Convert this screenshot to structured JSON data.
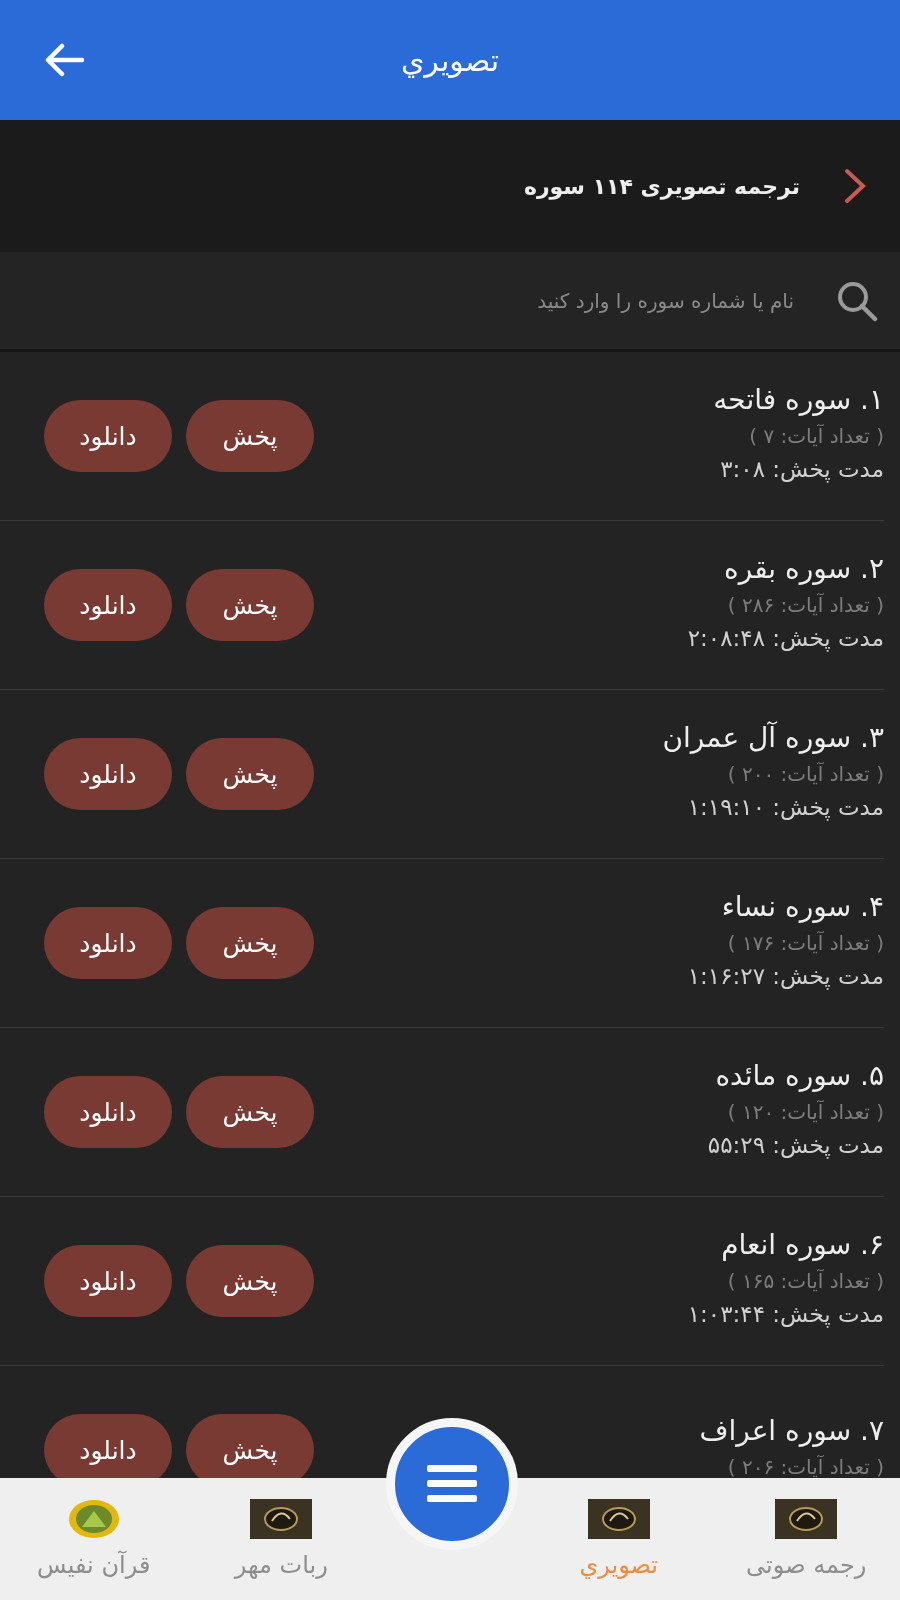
{
  "app_bar": {
    "title": "تصويري"
  },
  "banner": {
    "text": "ترجمه تصویری ۱۱۴ سوره"
  },
  "search": {
    "placeholder": "نام یا شماره سوره را وارد کنید"
  },
  "surahs": [
    {
      "title": "۱. سوره فاتحه",
      "verses": "( تعداد آیات: ۷ )",
      "duration": "مدت پخش: ۳:۰۸",
      "play": "پخش",
      "download": "دانلود"
    },
    {
      "title": "۲. سوره بقره",
      "verses": "( تعداد آیات: ۲۸۶ )",
      "duration": "مدت پخش: ۲:۰۸:۴۸",
      "play": "پخش",
      "download": "دانلود"
    },
    {
      "title": "۳. سوره آل عمران",
      "verses": "( تعداد آیات: ۲۰۰ )",
      "duration": "مدت پخش: ۱:۱۹:۱۰",
      "play": "پخش",
      "download": "دانلود"
    },
    {
      "title": "۴. سوره نساء",
      "verses": "( تعداد آیات: ۱۷۶ )",
      "duration": "مدت پخش: ۱:۱۶:۲۷",
      "play": "پخش",
      "download": "دانلود"
    },
    {
      "title": "۵. سوره مائده",
      "verses": "( تعداد آیات: ۱۲۰ )",
      "duration": "مدت پخش: ۵۵:۲۹",
      "play": "پخش",
      "download": "دانلود"
    },
    {
      "title": "۶. سوره انعام",
      "verses": "( تعداد آیات: ۱۶۵ )",
      "duration": "مدت پخش: ۱:۰۳:۴۴",
      "play": "پخش",
      "download": "دانلود"
    },
    {
      "title": "۷. سوره اعراف",
      "verses": "( تعداد آیات: ۲۰۶ )",
      "play": "پخش",
      "download": "دانلود"
    }
  ],
  "bottom_nav": {
    "items": [
      {
        "label": "رجمه صوتی",
        "kind": "book",
        "selected": false
      },
      {
        "label": "تصويري",
        "kind": "book",
        "selected": true
      },
      {
        "label": "ربات مهر",
        "kind": "book",
        "selected": false
      },
      {
        "label": "قرآن نفیس",
        "kind": "emblem",
        "selected": false
      }
    ]
  }
}
